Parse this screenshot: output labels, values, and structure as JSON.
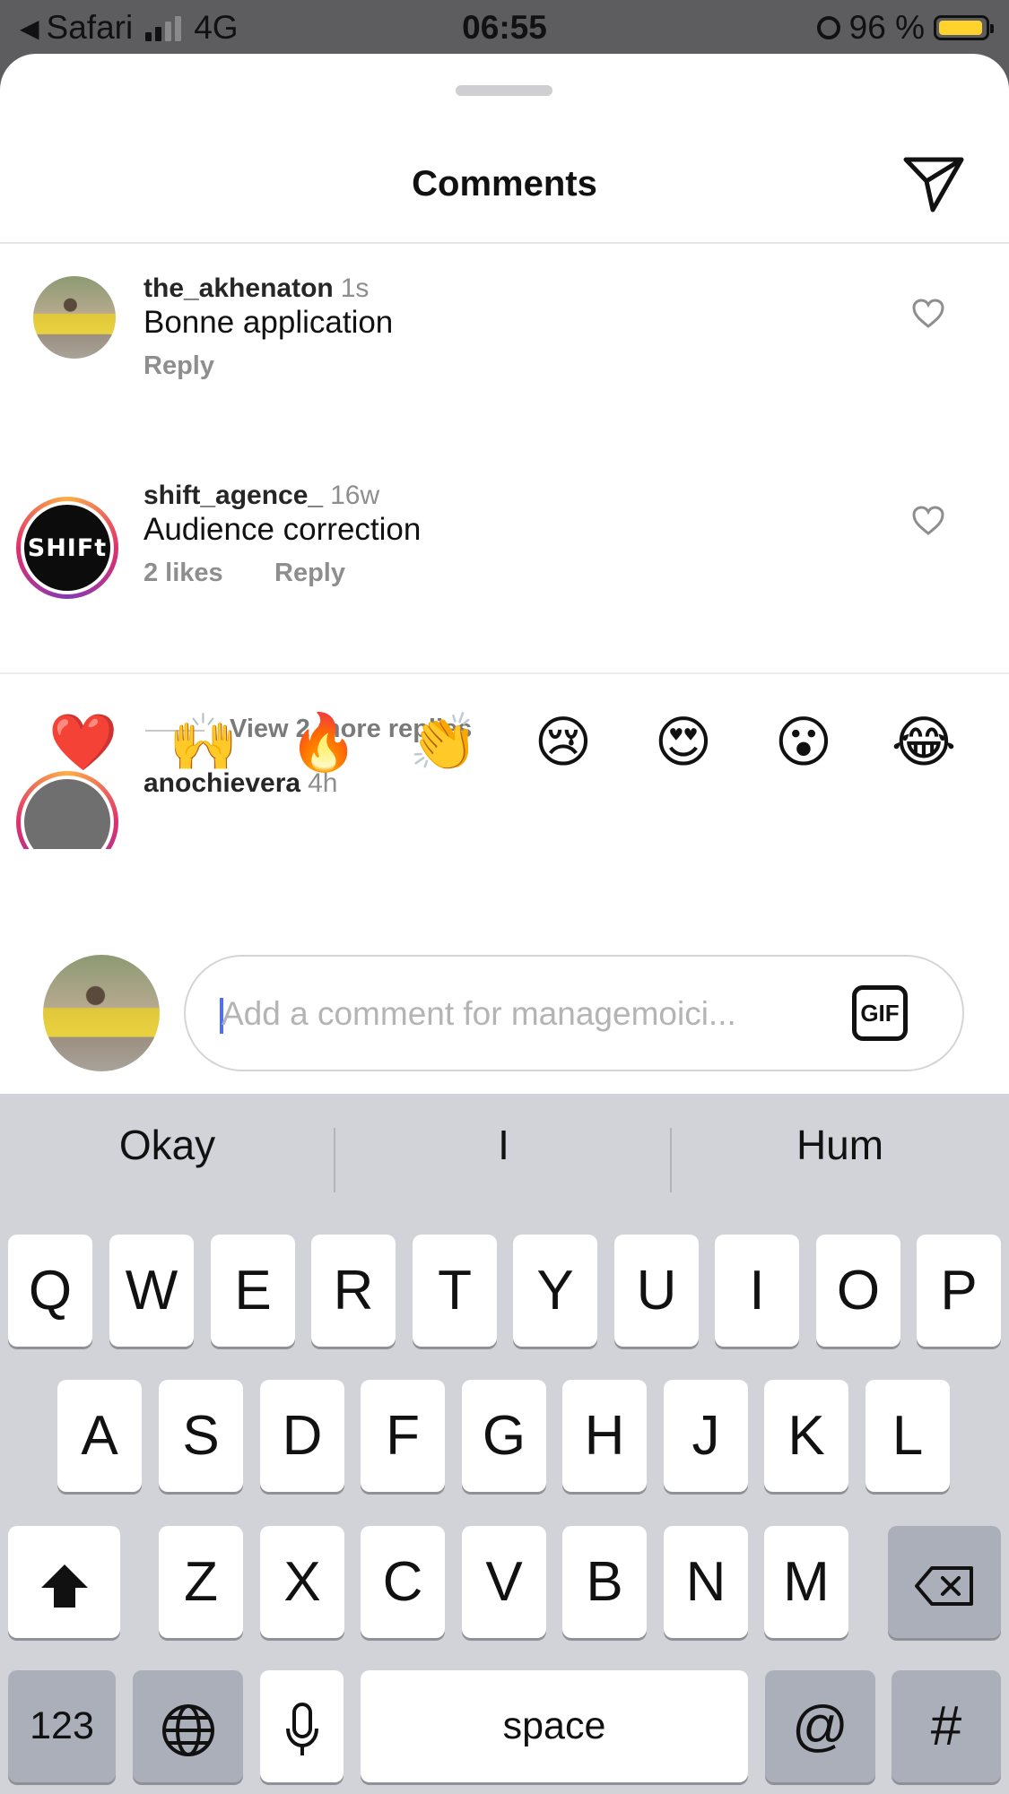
{
  "status_bar": {
    "back_app": "Safari",
    "network": "4G",
    "time": "06:55",
    "battery": "96 %"
  },
  "sheet": {
    "title": "Comments"
  },
  "comments": [
    {
      "username": "the_akhenaton",
      "time": "1s",
      "text": "Bonne application",
      "reply_label": "Reply"
    },
    {
      "username": "shift_agence_",
      "time": "16w",
      "text": "Audience correction",
      "likes": "2 likes",
      "reply_label": "Reply",
      "view_replies": "View 2 more replies",
      "avatar_text": "SHIFt"
    },
    {
      "username": "anochievera",
      "time": "4h"
    }
  ],
  "emojis": [
    "❤️",
    "🙌",
    "🔥",
    "👏",
    "😢",
    "😍",
    "😮",
    "😂"
  ],
  "composer": {
    "placeholder": "Add a comment for managemoici...",
    "gif_label": "GIF"
  },
  "keyboard": {
    "suggestions": [
      "Okay",
      "I",
      "Hum"
    ],
    "row1": [
      "Q",
      "W",
      "E",
      "R",
      "T",
      "Y",
      "U",
      "I",
      "O",
      "P"
    ],
    "row2": [
      "A",
      "S",
      "D",
      "F",
      "G",
      "H",
      "J",
      "K",
      "L"
    ],
    "row3": [
      "Z",
      "X",
      "C",
      "V",
      "B",
      "N",
      "M"
    ],
    "numbers_key": "123",
    "space_key": "space",
    "at_key": "@",
    "hash_key": "#"
  },
  "colors": {
    "battery": "#ffd22e",
    "cursor": "#4d6dff",
    "ring": "#e1306c"
  }
}
